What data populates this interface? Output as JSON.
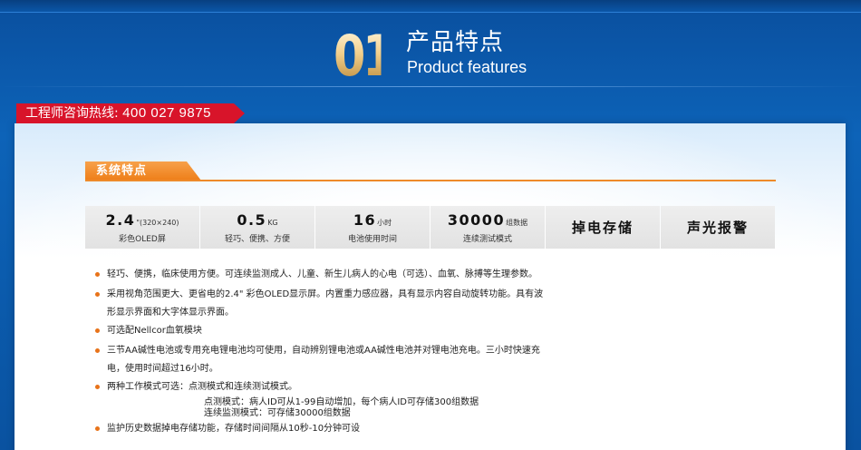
{
  "header": {
    "number": "01",
    "title": "产品特点",
    "subtitle": "Product features"
  },
  "hotline": {
    "label": "工程师咨询热线:",
    "number": "400 027 9875"
  },
  "section": {
    "title": "系统特点"
  },
  "features": [
    {
      "value": "2.4",
      "unit": "\"(320×240)",
      "caption": "彩色OLED屏"
    },
    {
      "value": "0.5",
      "unit": "KG",
      "caption": "轻巧、便携、方便"
    },
    {
      "value": "16",
      "unit": "小时",
      "caption": "电池使用时间"
    },
    {
      "value": "30000",
      "unit": "组数据",
      "caption": "连续测试模式"
    },
    {
      "label": "掉电存储"
    },
    {
      "label": "声光报警"
    }
  ],
  "bullets": [
    {
      "text": "轻巧、便携，临床使用方便。可连续监测成人、儿童、新生儿病人的心电（可选）、血氧、脉搏等生理参数。"
    },
    {
      "text": "采用视角范围更大、更省电的2.4\" 彩色OLED显示屏。内置重力感应器，具有显示内容自动旋转功能。具有波",
      "cont": "形显示界面和大字体显示界面。"
    },
    {
      "text": "可选配Nellcor血氧模块"
    },
    {
      "text": "三节AA碱性电池或专用充电锂电池均可使用，自动辨别锂电池或AA碱性电池并对锂电池充电。三小时快速充",
      "cont": "电，使用时间超过16小时。"
    },
    {
      "text": "两种工作模式可选：点测模式和连续测试模式。",
      "sub1": "点测模式：病人ID可从1-99自动增加，每个病人ID可存储300组数据",
      "sub2": "连续监测模式：可存储30000组数据"
    },
    {
      "text": "监护历史数据掉电存储功能，存储时间间隔从10秒-10分钟可设"
    }
  ]
}
